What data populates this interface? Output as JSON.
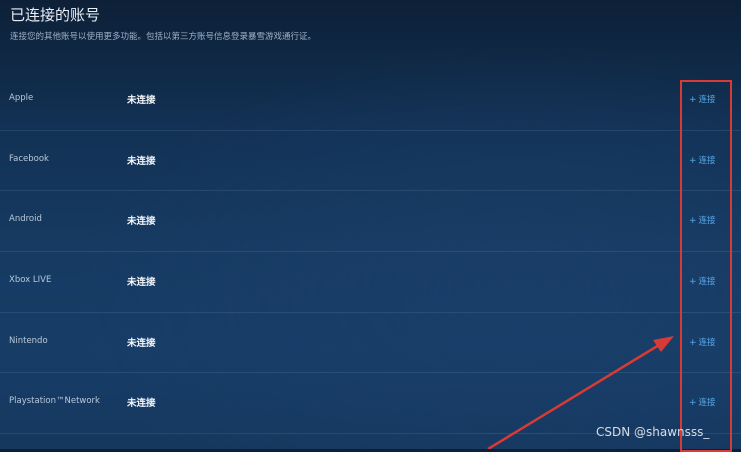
{
  "header": {
    "title": "已连接的账号",
    "subtitle": "连接您的其他账号以使用更多功能。包括以第三方账号信息登录暴雪游戏通行证。"
  },
  "accounts": [
    {
      "name": "Apple",
      "status": "未连接",
      "action": "连接"
    },
    {
      "name": "Facebook",
      "status": "未连接",
      "action": "连接"
    },
    {
      "name": "Android",
      "status": "未连接",
      "action": "连接"
    },
    {
      "name": "Xbox LIVE",
      "status": "未连接",
      "action": "连接"
    },
    {
      "name": "Nintendo",
      "status": "未连接",
      "action": "连接"
    },
    {
      "name": "Playstation™Network",
      "status": "未连接",
      "action": "连接"
    }
  ],
  "icons": {
    "connect": "plus-icon"
  },
  "colors": {
    "accent": "#5aa9ea",
    "annotation": "#d83a35"
  },
  "watermark": "CSDN @shawnsss_"
}
